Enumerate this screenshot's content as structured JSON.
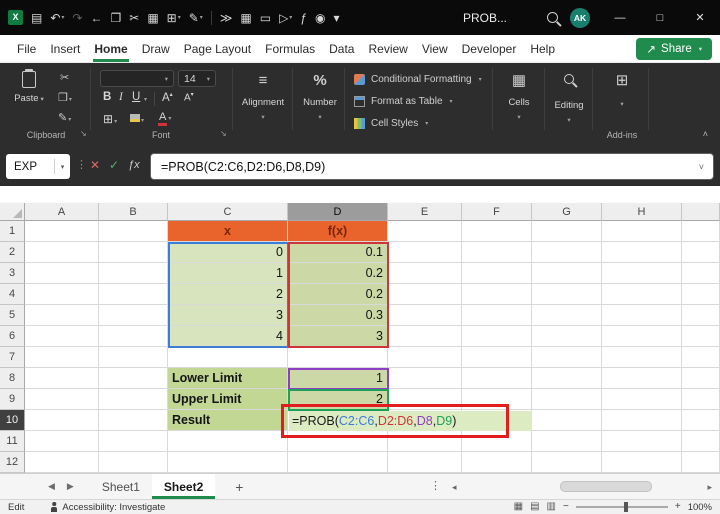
{
  "title_bar": {
    "title": "PROB...",
    "avatar_initials": "AK",
    "icons": [
      {
        "name": "excel-logo-icon",
        "glyph": "X",
        "kind": "logo"
      },
      {
        "name": "save-icon",
        "glyph": "▤"
      },
      {
        "name": "undo-icon",
        "glyph": "↶",
        "dropdown": true
      },
      {
        "name": "redo-icon",
        "glyph": "↷",
        "disabled": true
      },
      {
        "name": "back-icon",
        "glyph": "←"
      },
      {
        "name": "copy-icon",
        "glyph": "❐"
      },
      {
        "name": "cut-icon",
        "glyph": "✂"
      },
      {
        "name": "picture-icon",
        "glyph": "▦"
      },
      {
        "name": "borders-icon",
        "glyph": "⊞",
        "dropdown": true
      },
      {
        "name": "format-painter-icon",
        "glyph": "✎",
        "dropdown": true
      },
      {
        "name": "qat-separator",
        "kind": "separator"
      },
      {
        "name": "indent-icon",
        "glyph": "≫"
      },
      {
        "name": "table-icon",
        "glyph": "▦"
      },
      {
        "name": "delete-icon",
        "glyph": "▭"
      },
      {
        "name": "macro-play-icon",
        "glyph": "▷",
        "dropdown": true
      },
      {
        "name": "function-icon",
        "glyph": "ƒ"
      },
      {
        "name": "record-macro-icon",
        "glyph": "◉"
      },
      {
        "name": "more-commands-icon",
        "glyph": "▾"
      }
    ],
    "window_controls": [
      {
        "name": "minimize-button",
        "glyph": "—"
      },
      {
        "name": "maximize-button",
        "glyph": "□"
      },
      {
        "name": "close-button",
        "glyph": "✕"
      }
    ]
  },
  "menu": {
    "tabs": [
      "File",
      "Insert",
      "Home",
      "Draw",
      "Page Layout",
      "Formulas",
      "Data",
      "Review",
      "View",
      "Developer",
      "Help"
    ],
    "active_tab": "Home",
    "share_label": "Share"
  },
  "ribbon": {
    "paste_label": "Paste",
    "clipboard_group_label": "Clipboard",
    "font_group_label": "Font",
    "font_size": "14",
    "bold_label": "B",
    "italic_label": "I",
    "underline_label": "U",
    "alignment_label": "Alignment",
    "number_label": "Number",
    "styles_items": [
      "Conditional Formatting",
      "Format as Table",
      "Cell Styles"
    ],
    "cells_label": "Cells",
    "editing_label": "Editing",
    "addins_label": "Add-ins"
  },
  "formula_bar": {
    "name_box_value": "EXP",
    "formula": "=PROB(C2:C6,D2:D6,D8,D9)"
  },
  "sheet": {
    "column_headers": [
      "A",
      "B",
      "C",
      "D",
      "E",
      "F",
      "G",
      "H",
      ""
    ],
    "row_headers": [
      "1",
      "2",
      "3",
      "4",
      "5",
      "6",
      "7",
      "8",
      "9",
      "10",
      "11",
      "12"
    ],
    "active_column": "D",
    "active_row": "10",
    "table": {
      "header_x": "x",
      "header_fx": "f(x)",
      "x_values": [
        "0",
        "1",
        "2",
        "3",
        "4"
      ],
      "fx_values": [
        "0.1",
        "0.2",
        "0.2",
        "0.3",
        "3"
      ]
    },
    "labels": {
      "lower": "Lower Limit",
      "upper": "Upper Limit",
      "result": "Result"
    },
    "values": {
      "lower": "1",
      "upper": "2"
    },
    "formula_parts": [
      {
        "text": "=PROB(",
        "color": "#1a1a1a"
      },
      {
        "text": "C2:C6",
        "color": "#3b7dd8"
      },
      {
        "text": ",",
        "color": "#1a1a1a"
      },
      {
        "text": "D2:D6",
        "color": "#d13438"
      },
      {
        "text": ",",
        "color": "#1a1a1a"
      },
      {
        "text": "D8",
        "color": "#8e3ec4"
      },
      {
        "text": ",",
        "color": "#1a1a1a"
      },
      {
        "text": "D9",
        "color": "#1fa05a"
      },
      {
        "text": ")",
        "color": "#1a1a1a"
      }
    ]
  },
  "tab_bar": {
    "sheets": [
      {
        "name": "Sheet1",
        "active": false
      },
      {
        "name": "Sheet2",
        "active": true
      }
    ]
  },
  "status_bar": {
    "mode": "Edit",
    "accessibility": "Accessibility: Investigate",
    "zoom_out": "−",
    "zoom_in": "+",
    "zoom_percent": "100%"
  },
  "colors": {
    "accent_green": "#1f8b4d",
    "header_orange": "#e8642c",
    "annotation_red": "#e11d1d",
    "ref_blue": "#3b7dd8",
    "ref_red": "#d13438",
    "ref_purple": "#8e3ec4",
    "ref_green": "#1fa05a"
  }
}
